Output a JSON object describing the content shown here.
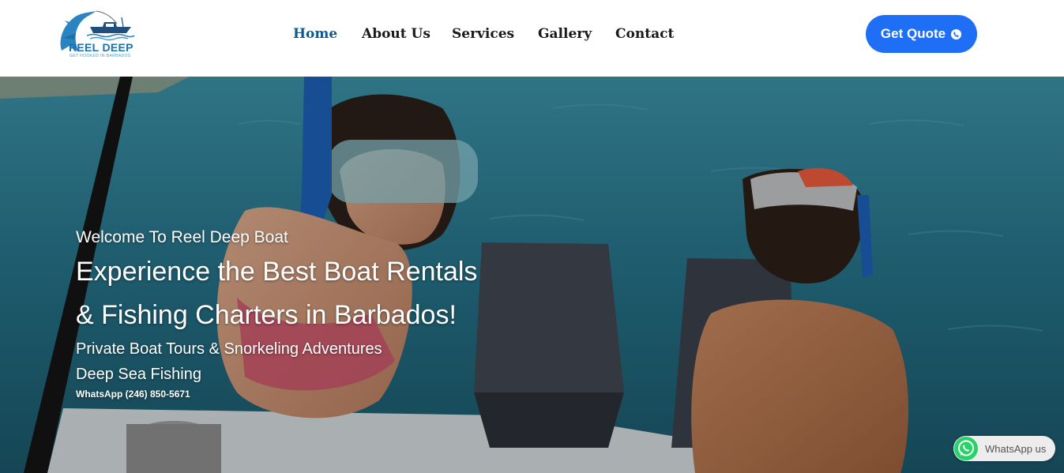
{
  "brand": {
    "name": "REEL DEEP",
    "tagline": "GET HOOKED IN BARBADOS"
  },
  "nav": {
    "items": [
      {
        "label": "Home",
        "active": true
      },
      {
        "label": "About Us",
        "active": false
      },
      {
        "label": "Services",
        "active": false
      },
      {
        "label": "Gallery",
        "active": false
      },
      {
        "label": "Contact",
        "active": false
      }
    ]
  },
  "header": {
    "cta_label": "Get Quote",
    "cta_icon": "whatsapp-icon"
  },
  "hero": {
    "welcome": "Welcome To Reel Deep Boat",
    "title_line1": "Experience the Best Boat Rentals",
    "title_line2": "& Fishing Charters in Barbados!",
    "sub_line1": "Private Boat Tours & Snorkeling Adventures",
    "sub_line2": "Deep Sea Fishing",
    "phone": "WhatsApp (246) 850-5671"
  },
  "floating": {
    "whatsapp_label": "WhatsApp us",
    "icon": "whatsapp-icon"
  },
  "colors": {
    "accent": "#1e6ff5",
    "nav_active": "#0d5a93",
    "whatsapp_green": "#25d366"
  }
}
